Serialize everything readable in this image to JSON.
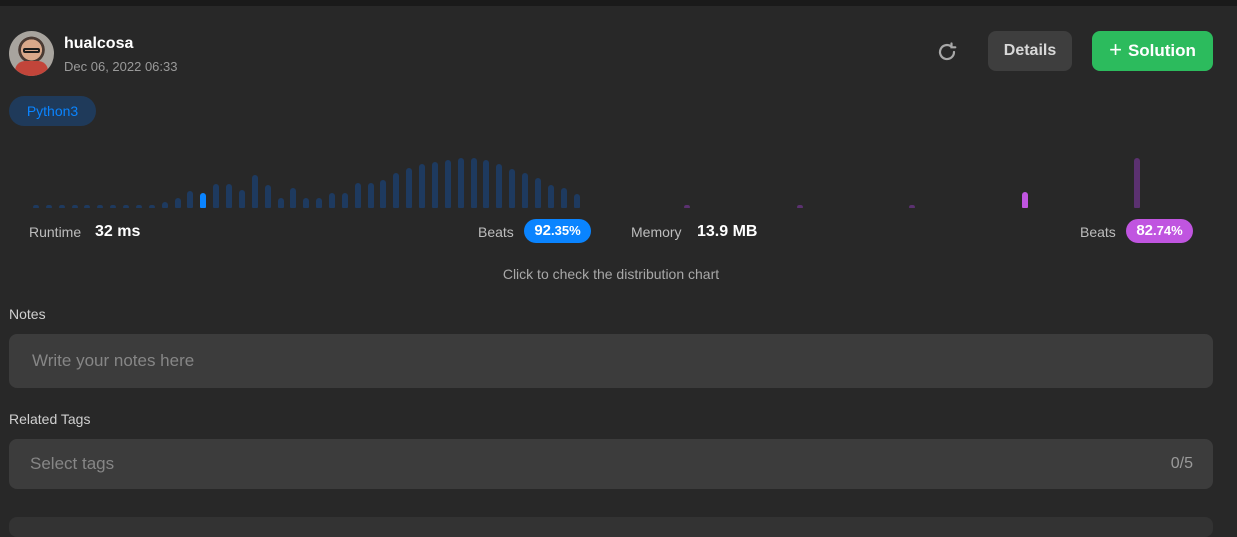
{
  "user": {
    "name": "hualcosa",
    "timestamp": "Dec 06, 2022 06:33"
  },
  "header": {
    "details_label": "Details",
    "solution_label": "Solution",
    "plus_glyph": "+"
  },
  "language": "Python3",
  "runtime": {
    "label": "Runtime",
    "value": "32 ms",
    "beats_label": "Beats",
    "beats_int": "92",
    "beats_frac": ".35%",
    "color": "#0a84ff"
  },
  "memory": {
    "label": "Memory",
    "value": "13.9 MB",
    "beats_label": "Beats",
    "beats_int": "82",
    "beats_frac": ".74%",
    "color": "#c055e0"
  },
  "distribution": {
    "hint": "Click to check the distribution chart",
    "runtime_bar_levels": [
      0.05,
      0.05,
      0.05,
      0.05,
      0.05,
      0.05,
      0.05,
      0.05,
      0.05,
      0.05,
      0.12,
      0.2,
      0.33,
      0.3,
      0.48,
      0.48,
      0.35,
      0.65,
      0.45,
      0.2,
      0.4,
      0.2,
      0.2,
      0.3,
      0.3,
      0.5,
      0.5,
      0.55,
      0.7,
      0.8,
      0.88,
      0.92,
      0.96,
      1.0,
      1.0,
      0.96,
      0.88,
      0.78,
      0.7,
      0.6,
      0.45,
      0.4,
      0.28
    ],
    "runtime_highlight_index": 13,
    "memory_bar_levels": [
      0.05,
      0.05,
      0.05,
      0.32,
      1.0
    ],
    "memory_highlight_index": 3
  },
  "notes": {
    "label": "Notes",
    "placeholder": "Write your notes here"
  },
  "tags": {
    "label": "Related Tags",
    "placeholder": "Select tags",
    "count": "0/5"
  },
  "colors": {
    "runtime_bar": "#1e3a5f",
    "runtime_highlight": "#0a84ff",
    "memory_bar": "#5b3170",
    "memory_highlight": "#c055e0",
    "solution_green": "#2cbb5d"
  }
}
